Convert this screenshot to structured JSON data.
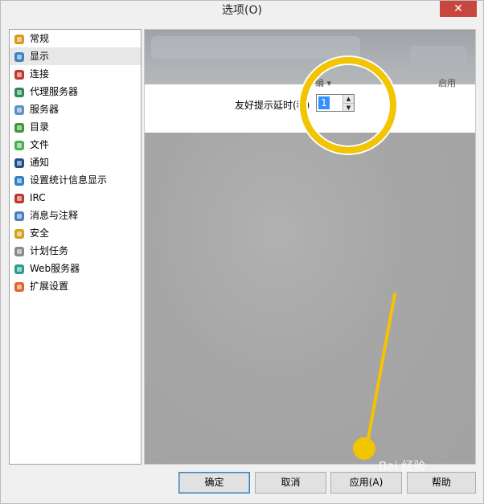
{
  "window": {
    "title": "选项(O)",
    "close_symbol": "✕"
  },
  "sidebar": {
    "items": [
      {
        "label": "常规",
        "icon": "settings-gear-icon",
        "color": "#d99a1a"
      },
      {
        "label": "显示",
        "icon": "monitor-icon",
        "color": "#3b82c4",
        "selected": true
      },
      {
        "label": "连接",
        "icon": "connection-plug-icon",
        "color": "#c0392b"
      },
      {
        "label": "代理服务器",
        "icon": "proxy-icon",
        "color": "#2e8b57"
      },
      {
        "label": "服务器",
        "icon": "server-icon",
        "color": "#5d8fc9"
      },
      {
        "label": "目录",
        "icon": "folder-icon",
        "color": "#3a9a3a"
      },
      {
        "label": "文件",
        "icon": "file-icon",
        "color": "#4caf50"
      },
      {
        "label": "通知",
        "icon": "notification-icon",
        "color": "#1f4e8c"
      },
      {
        "label": "设置统计信息显示",
        "icon": "statistics-icon",
        "color": "#2f80c8"
      },
      {
        "label": "IRC",
        "icon": "irc-icon",
        "color": "#c0392b"
      },
      {
        "label": "消息与注释",
        "icon": "message-icon",
        "color": "#4a7fc1"
      },
      {
        "label": "安全",
        "icon": "lock-icon",
        "color": "#d4a017"
      },
      {
        "label": "计划任务",
        "icon": "calendar-icon",
        "color": "#8a8a8a"
      },
      {
        "label": "Web服务器",
        "icon": "globe-icon",
        "color": "#2a9d8f"
      },
      {
        "label": "扩展设置",
        "icon": "extension-icon",
        "color": "#e0662f"
      }
    ]
  },
  "content": {
    "partial_left_text": "编 ▾",
    "partial_right_text": "启用",
    "delay_label": "友好提示延时(秒)",
    "delay_value": "1",
    "spin_up": "▲",
    "spin_down": "▼"
  },
  "buttons": {
    "ok": "确定",
    "cancel": "取消",
    "apply": "应用(A)",
    "help": "帮助"
  },
  "watermark": {
    "text": "Bai 经验"
  },
  "colors": {
    "highlight": "#f3c400",
    "selection": "#3390ff"
  }
}
